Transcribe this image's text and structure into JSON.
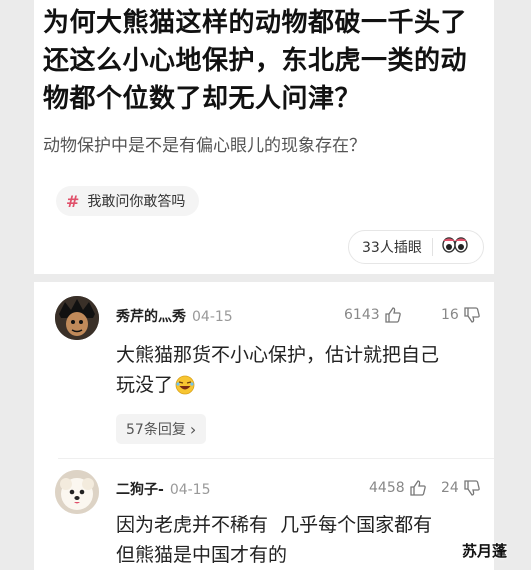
{
  "question": {
    "title": "为何大熊猫这样的动物都破一千头了还这么小心地保护，东北虎一类的动物都个位数了却无人问津？",
    "subtitle": "动物保护中是不是有偏心眼儿的现象存在？",
    "tag": "我敢问你敢答吗",
    "tag_icon": "hash-icon",
    "viewers": "33人插眼"
  },
  "comments": [
    {
      "user": "秀芹的灬秀",
      "date": "04-15",
      "likes": "6143",
      "dislikes": "16",
      "text_line1": "大熊猫那货不小心保护，估计就把自己",
      "text_line2": "玩没了",
      "emoji": "laughing-emoji",
      "replies": "57条回复",
      "replies_arrow": "›"
    },
    {
      "user": "二狗子-",
      "date": "04-15",
      "likes": "4458",
      "dislikes": "24",
      "text_line1": "因为老虎并不稀有  几乎每个国家都有",
      "text_line2": "但熊猫是中国才有的"
    }
  ],
  "watermark": "苏月蓬",
  "colors": {
    "accent": "#e0506a",
    "background": "#ebebeb",
    "card": "#ffffff"
  }
}
